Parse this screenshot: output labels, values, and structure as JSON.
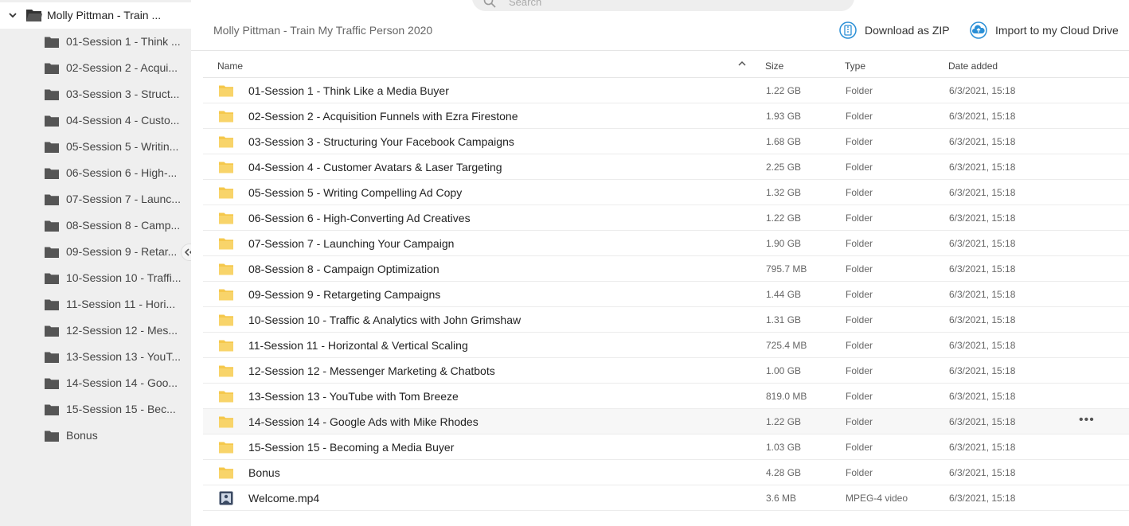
{
  "sidebar": {
    "root_label": "Molly Pittman - Train ...",
    "items": [
      {
        "label": "01-Session 1 - Think ..."
      },
      {
        "label": "02-Session 2 - Acqui..."
      },
      {
        "label": "03-Session 3 - Struct..."
      },
      {
        "label": "04-Session 4 - Custo..."
      },
      {
        "label": "05-Session 5 - Writin..."
      },
      {
        "label": "06-Session 6 - High-..."
      },
      {
        "label": "07-Session 7 - Launc..."
      },
      {
        "label": "08-Session 8 - Camp..."
      },
      {
        "label": "09-Session 9 - Retar..."
      },
      {
        "label": "10-Session 10 - Traffi..."
      },
      {
        "label": "11-Session 11 - Hori..."
      },
      {
        "label": "12-Session 12 - Mes..."
      },
      {
        "label": "13-Session 13 - YouT..."
      },
      {
        "label": "14-Session 14 - Goo..."
      },
      {
        "label": "15-Session 15 - Bec..."
      },
      {
        "label": "Bonus"
      }
    ]
  },
  "search": {
    "placeholder": "Search"
  },
  "header": {
    "breadcrumb": "Molly Pittman - Train My Traffic Person 2020",
    "download_label": "Download as ZIP",
    "import_label": "Import to my Cloud Drive"
  },
  "table": {
    "columns": {
      "name": "Name",
      "size": "Size",
      "type": "Type",
      "date": "Date added"
    },
    "more_label": "•••",
    "rows": [
      {
        "name": "01-Session 1 - Think Like a Media Buyer",
        "size": "1.22 GB",
        "type": "Folder",
        "date": "6/3/2021, 15:18",
        "icon": "folder-icon"
      },
      {
        "name": "02-Session 2 - Acquisition Funnels with Ezra Firestone",
        "size": "1.93 GB",
        "type": "Folder",
        "date": "6/3/2021, 15:18",
        "icon": "folder-icon"
      },
      {
        "name": "03-Session 3 - Structuring Your Facebook Campaigns",
        "size": "1.68 GB",
        "type": "Folder",
        "date": "6/3/2021, 15:18",
        "icon": "folder-icon"
      },
      {
        "name": "04-Session 4 - Customer Avatars & Laser Targeting",
        "size": "2.25 GB",
        "type": "Folder",
        "date": "6/3/2021, 15:18",
        "icon": "folder-icon"
      },
      {
        "name": "05-Session 5 - Writing Compelling Ad Copy",
        "size": "1.32 GB",
        "type": "Folder",
        "date": "6/3/2021, 15:18",
        "icon": "folder-icon"
      },
      {
        "name": "06-Session 6 - High-Converting Ad Creatives",
        "size": "1.22 GB",
        "type": "Folder",
        "date": "6/3/2021, 15:18",
        "icon": "folder-icon"
      },
      {
        "name": "07-Session 7 - Launching Your Campaign",
        "size": "1.90 GB",
        "type": "Folder",
        "date": "6/3/2021, 15:18",
        "icon": "folder-icon"
      },
      {
        "name": "08-Session 8 - Campaign Optimization",
        "size": "795.7 MB",
        "type": "Folder",
        "date": "6/3/2021, 15:18",
        "icon": "folder-icon"
      },
      {
        "name": "09-Session 9 - Retargeting Campaigns",
        "size": "1.44 GB",
        "type": "Folder",
        "date": "6/3/2021, 15:18",
        "icon": "folder-icon"
      },
      {
        "name": "10-Session 10 - Traffic & Analytics with John Grimshaw",
        "size": "1.31 GB",
        "type": "Folder",
        "date": "6/3/2021, 15:18",
        "icon": "folder-icon"
      },
      {
        "name": "11-Session 11 - Horizontal & Vertical Scaling",
        "size": "725.4 MB",
        "type": "Folder",
        "date": "6/3/2021, 15:18",
        "icon": "folder-icon"
      },
      {
        "name": "12-Session 12 - Messenger Marketing & Chatbots",
        "size": "1.00 GB",
        "type": "Folder",
        "date": "6/3/2021, 15:18",
        "icon": "folder-icon"
      },
      {
        "name": "13-Session 13 - YouTube with Tom Breeze",
        "size": "819.0 MB",
        "type": "Folder",
        "date": "6/3/2021, 15:18",
        "icon": "folder-icon"
      },
      {
        "name": "14-Session 14 - Google Ads with Mike Rhodes",
        "size": "1.22 GB",
        "type": "Folder",
        "date": "6/3/2021, 15:18",
        "icon": "folder-icon"
      },
      {
        "name": "15-Session 15 - Becoming a Media Buyer",
        "size": "1.03 GB",
        "type": "Folder",
        "date": "6/3/2021, 15:18",
        "icon": "folder-icon"
      },
      {
        "name": "Bonus",
        "size": "4.28 GB",
        "type": "Folder",
        "date": "6/3/2021, 15:18",
        "icon": "folder-icon"
      },
      {
        "name": "Welcome.mp4",
        "size": "3.6 MB",
        "type": "MPEG-4 video",
        "date": "6/3/2021, 15:18",
        "icon": "video-file-icon"
      }
    ]
  },
  "colors": {
    "folder": "#f5c84c",
    "sidebar_folder": "#555555",
    "accent": "#2a8fd6",
    "sidebar_bg": "#efefef"
  }
}
